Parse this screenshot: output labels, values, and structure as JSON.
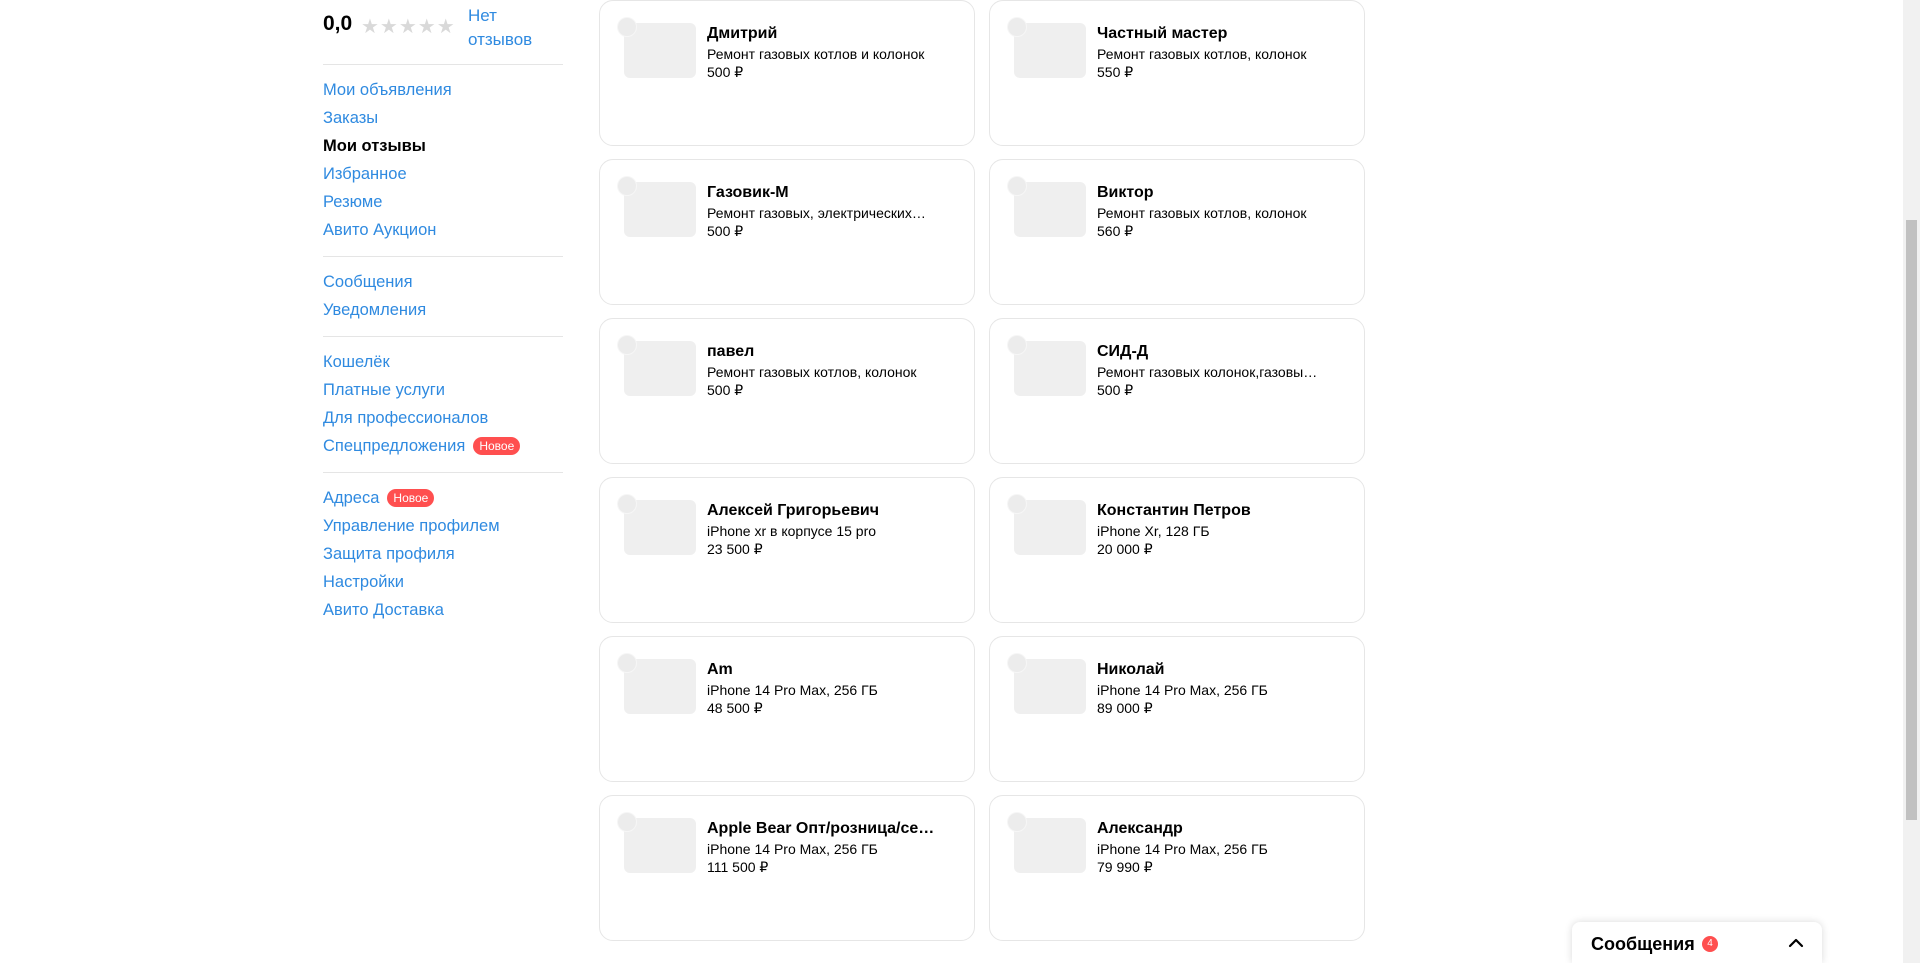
{
  "profile": {
    "rating": "0,0",
    "stars": "★★★★★",
    "no_reviews": "Нет отзывов"
  },
  "sidebar": {
    "group1": [
      {
        "label": "Мои объявления",
        "active": false
      },
      {
        "label": "Заказы",
        "active": false
      },
      {
        "label": "Мои отзывы",
        "active": true
      },
      {
        "label": "Избранное",
        "active": false
      },
      {
        "label": "Резюме",
        "active": false
      },
      {
        "label": "Авито Аукцион",
        "active": false
      }
    ],
    "group2": [
      {
        "label": "Сообщения"
      },
      {
        "label": "Уведомления"
      }
    ],
    "group3": [
      {
        "label": "Кошелёк"
      },
      {
        "label": "Платные услуги"
      },
      {
        "label": "Для профессионалов"
      },
      {
        "label": "Спецпредложения",
        "badge": "Новое"
      }
    ],
    "group4": [
      {
        "label": "Адреса",
        "badge": "Новое"
      },
      {
        "label": "Управление профилем"
      },
      {
        "label": "Защита профиля"
      },
      {
        "label": "Настройки"
      },
      {
        "label": "Авито Доставка"
      }
    ]
  },
  "cards": [
    {
      "name": "Дмитрий",
      "desc": "Ремонт газовых котлов и колонок",
      "price": "500 ₽"
    },
    {
      "name": "Частный мастер",
      "desc": "Ремонт газовых котлов, колонок",
      "price": "550 ₽"
    },
    {
      "name": "Газовик-М",
      "desc": "Ремонт газовых, электрических котлов",
      "price": "500 ₽"
    },
    {
      "name": "Виктор",
      "desc": "Ремонт газовых котлов, колонок",
      "price": "560 ₽"
    },
    {
      "name": "павел",
      "desc": "Ремонт газовых котлов, колонок",
      "price": "500 ₽"
    },
    {
      "name": "СИД-Д",
      "desc": "Ремонт газовых колонок,газовых котлов",
      "price": "500 ₽"
    },
    {
      "name": "Алексей Григорьевич",
      "desc": "iPhone xr в корпусе 15 pro",
      "price": "23 500 ₽"
    },
    {
      "name": "Константин Петров",
      "desc": "iPhone Xr, 128 ГБ",
      "price": "20 000 ₽"
    },
    {
      "name": "Am",
      "desc": "iPhone 14 Pro Max, 256 ГБ",
      "price": "48 500 ₽"
    },
    {
      "name": "Николай",
      "desc": "iPhone 14 Pro Max, 256 ГБ",
      "price": "89 000 ₽"
    },
    {
      "name": "Apple Bear Опт/розница/сервис",
      "desc": "iPhone 14 Pro Max, 256 ГБ",
      "price": "111 500 ₽"
    },
    {
      "name": "Александр",
      "desc": "iPhone 14 Pro Max, 256 ГБ",
      "price": "79 990 ₽"
    }
  ],
  "messages_bar": {
    "label": "Сообщения",
    "count": "4"
  }
}
